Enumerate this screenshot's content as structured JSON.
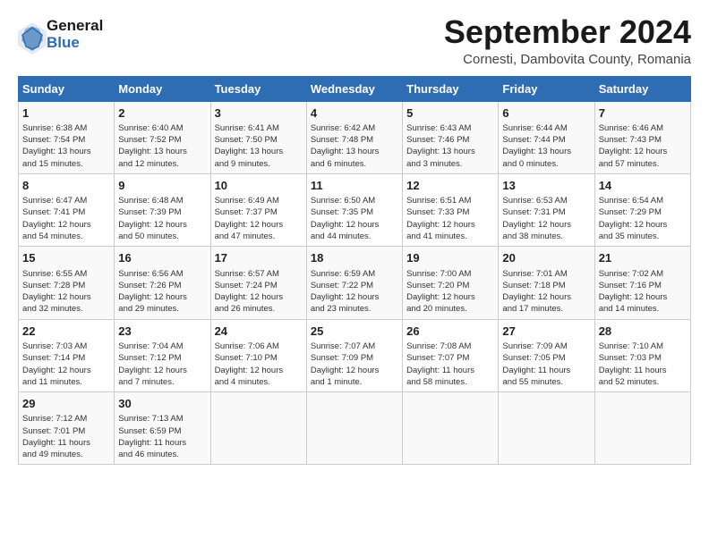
{
  "logo": {
    "line1": "General",
    "line2": "Blue"
  },
  "title": "September 2024",
  "subtitle": "Cornesti, Dambovita County, Romania",
  "header_color": "#2e6db4",
  "days_of_week": [
    "Sunday",
    "Monday",
    "Tuesday",
    "Wednesday",
    "Thursday",
    "Friday",
    "Saturday"
  ],
  "weeks": [
    [
      {
        "day": "1",
        "info": "Sunrise: 6:38 AM\nSunset: 7:54 PM\nDaylight: 13 hours\nand 15 minutes."
      },
      {
        "day": "2",
        "info": "Sunrise: 6:40 AM\nSunset: 7:52 PM\nDaylight: 13 hours\nand 12 minutes."
      },
      {
        "day": "3",
        "info": "Sunrise: 6:41 AM\nSunset: 7:50 PM\nDaylight: 13 hours\nand 9 minutes."
      },
      {
        "day": "4",
        "info": "Sunrise: 6:42 AM\nSunset: 7:48 PM\nDaylight: 13 hours\nand 6 minutes."
      },
      {
        "day": "5",
        "info": "Sunrise: 6:43 AM\nSunset: 7:46 PM\nDaylight: 13 hours\nand 3 minutes."
      },
      {
        "day": "6",
        "info": "Sunrise: 6:44 AM\nSunset: 7:44 PM\nDaylight: 13 hours\nand 0 minutes."
      },
      {
        "day": "7",
        "info": "Sunrise: 6:46 AM\nSunset: 7:43 PM\nDaylight: 12 hours\nand 57 minutes."
      }
    ],
    [
      {
        "day": "8",
        "info": "Sunrise: 6:47 AM\nSunset: 7:41 PM\nDaylight: 12 hours\nand 54 minutes."
      },
      {
        "day": "9",
        "info": "Sunrise: 6:48 AM\nSunset: 7:39 PM\nDaylight: 12 hours\nand 50 minutes."
      },
      {
        "day": "10",
        "info": "Sunrise: 6:49 AM\nSunset: 7:37 PM\nDaylight: 12 hours\nand 47 minutes."
      },
      {
        "day": "11",
        "info": "Sunrise: 6:50 AM\nSunset: 7:35 PM\nDaylight: 12 hours\nand 44 minutes."
      },
      {
        "day": "12",
        "info": "Sunrise: 6:51 AM\nSunset: 7:33 PM\nDaylight: 12 hours\nand 41 minutes."
      },
      {
        "day": "13",
        "info": "Sunrise: 6:53 AM\nSunset: 7:31 PM\nDaylight: 12 hours\nand 38 minutes."
      },
      {
        "day": "14",
        "info": "Sunrise: 6:54 AM\nSunset: 7:29 PM\nDaylight: 12 hours\nand 35 minutes."
      }
    ],
    [
      {
        "day": "15",
        "info": "Sunrise: 6:55 AM\nSunset: 7:28 PM\nDaylight: 12 hours\nand 32 minutes."
      },
      {
        "day": "16",
        "info": "Sunrise: 6:56 AM\nSunset: 7:26 PM\nDaylight: 12 hours\nand 29 minutes."
      },
      {
        "day": "17",
        "info": "Sunrise: 6:57 AM\nSunset: 7:24 PM\nDaylight: 12 hours\nand 26 minutes."
      },
      {
        "day": "18",
        "info": "Sunrise: 6:59 AM\nSunset: 7:22 PM\nDaylight: 12 hours\nand 23 minutes."
      },
      {
        "day": "19",
        "info": "Sunrise: 7:00 AM\nSunset: 7:20 PM\nDaylight: 12 hours\nand 20 minutes."
      },
      {
        "day": "20",
        "info": "Sunrise: 7:01 AM\nSunset: 7:18 PM\nDaylight: 12 hours\nand 17 minutes."
      },
      {
        "day": "21",
        "info": "Sunrise: 7:02 AM\nSunset: 7:16 PM\nDaylight: 12 hours\nand 14 minutes."
      }
    ],
    [
      {
        "day": "22",
        "info": "Sunrise: 7:03 AM\nSunset: 7:14 PM\nDaylight: 12 hours\nand 11 minutes."
      },
      {
        "day": "23",
        "info": "Sunrise: 7:04 AM\nSunset: 7:12 PM\nDaylight: 12 hours\nand 7 minutes."
      },
      {
        "day": "24",
        "info": "Sunrise: 7:06 AM\nSunset: 7:10 PM\nDaylight: 12 hours\nand 4 minutes."
      },
      {
        "day": "25",
        "info": "Sunrise: 7:07 AM\nSunset: 7:09 PM\nDaylight: 12 hours\nand 1 minute."
      },
      {
        "day": "26",
        "info": "Sunrise: 7:08 AM\nSunset: 7:07 PM\nDaylight: 11 hours\nand 58 minutes."
      },
      {
        "day": "27",
        "info": "Sunrise: 7:09 AM\nSunset: 7:05 PM\nDaylight: 11 hours\nand 55 minutes."
      },
      {
        "day": "28",
        "info": "Sunrise: 7:10 AM\nSunset: 7:03 PM\nDaylight: 11 hours\nand 52 minutes."
      }
    ],
    [
      {
        "day": "29",
        "info": "Sunrise: 7:12 AM\nSunset: 7:01 PM\nDaylight: 11 hours\nand 49 minutes."
      },
      {
        "day": "30",
        "info": "Sunrise: 7:13 AM\nSunset: 6:59 PM\nDaylight: 11 hours\nand 46 minutes."
      },
      {
        "day": "",
        "info": ""
      },
      {
        "day": "",
        "info": ""
      },
      {
        "day": "",
        "info": ""
      },
      {
        "day": "",
        "info": ""
      },
      {
        "day": "",
        "info": ""
      }
    ]
  ]
}
